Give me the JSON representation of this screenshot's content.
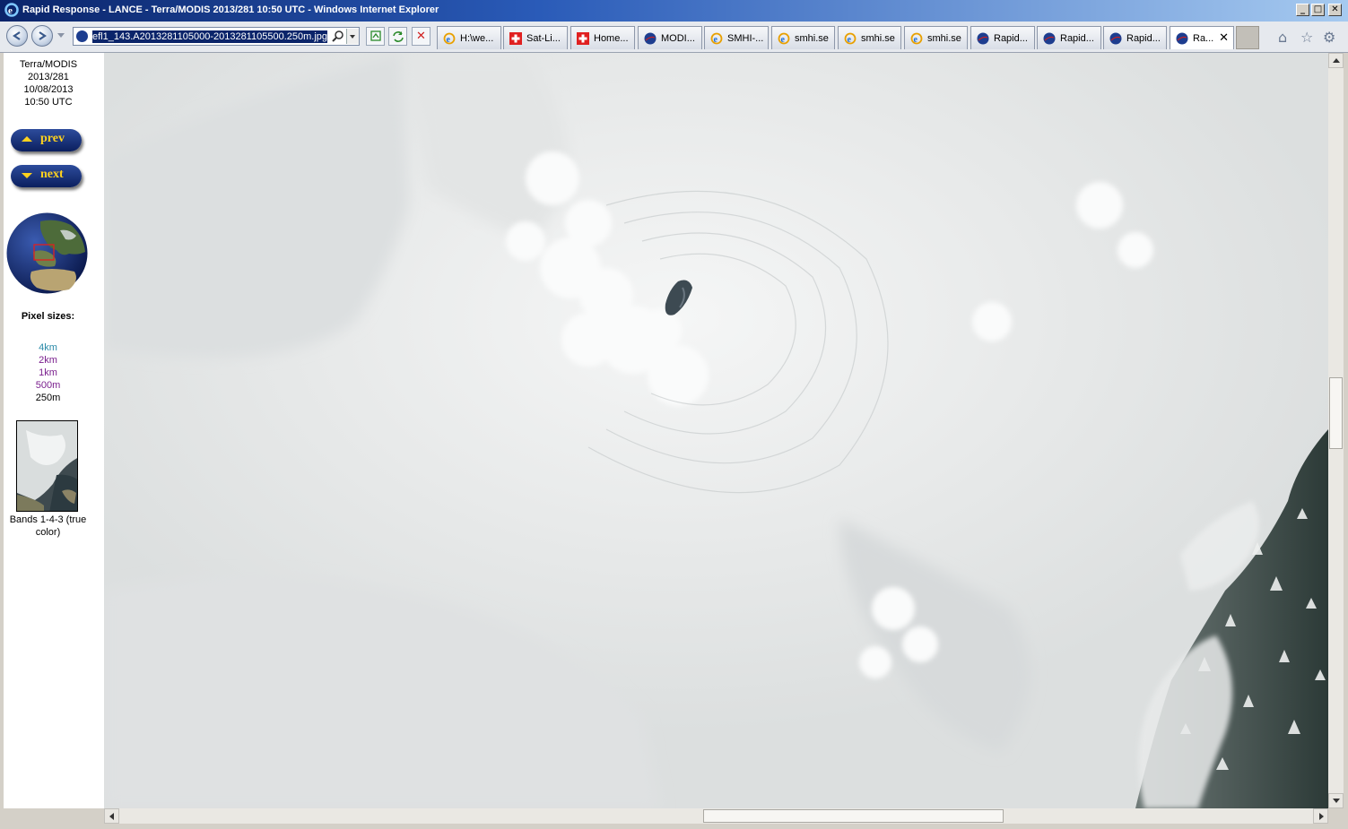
{
  "window": {
    "title": "Rapid Response - LANCE - Terra/MODIS 2013/281 10:50 UTC - Windows Internet Explorer",
    "minimize_glyph": "_",
    "maximize_glyph": "□",
    "close_glyph": "✕"
  },
  "navbar": {
    "url": "efl1_143.A2013281105000-2013281105500.250m.jpg",
    "tabs": [
      {
        "label": "H:\\we...",
        "icon": "ie-icon"
      },
      {
        "label": "Sat-Li...",
        "icon": "swiss-flag-icon"
      },
      {
        "label": "Home...",
        "icon": "swiss-flag-icon"
      },
      {
        "label": "MODI...",
        "icon": "nasa-icon"
      },
      {
        "label": "SMHI-...",
        "icon": "ie-icon"
      },
      {
        "label": "smhi.se",
        "icon": "ie-icon"
      },
      {
        "label": "smhi.se",
        "icon": "ie-icon"
      },
      {
        "label": "smhi.se",
        "icon": "ie-icon"
      },
      {
        "label": "Rapid...",
        "icon": "nasa-icon"
      },
      {
        "label": "Rapid...",
        "icon": "nasa-icon"
      },
      {
        "label": "Rapid...",
        "icon": "nasa-icon"
      },
      {
        "label": "Ra...",
        "icon": "nasa-icon",
        "active": true
      }
    ],
    "close_tab_glyph": "✕",
    "home_glyph": "⌂",
    "favorites_glyph": "☆",
    "tools_glyph": "⚙"
  },
  "sidebar": {
    "satellite": "Terra/MODIS",
    "date_doy": "2013/281",
    "date": "10/08/2013",
    "time": "10:50 UTC",
    "prev_label": "prev",
    "next_label": "next",
    "pixel_sizes_title": "Pixel sizes:",
    "pixel_sizes": [
      {
        "label": "4km",
        "color": "#2a8aa8"
      },
      {
        "label": "2km",
        "color": "#7a1f8e"
      },
      {
        "label": "1km",
        "color": "#7a1f8e"
      },
      {
        "label": "500m",
        "color": "#7a1f8e"
      },
      {
        "label": "250m",
        "color": "#000000"
      }
    ],
    "bands_caption": "Bands 1-4-3 (true color)"
  },
  "colors": {
    "link_nav": "#0b1f5e",
    "nav_text": "#ffd21e",
    "cloud": "#e9ebeb"
  }
}
